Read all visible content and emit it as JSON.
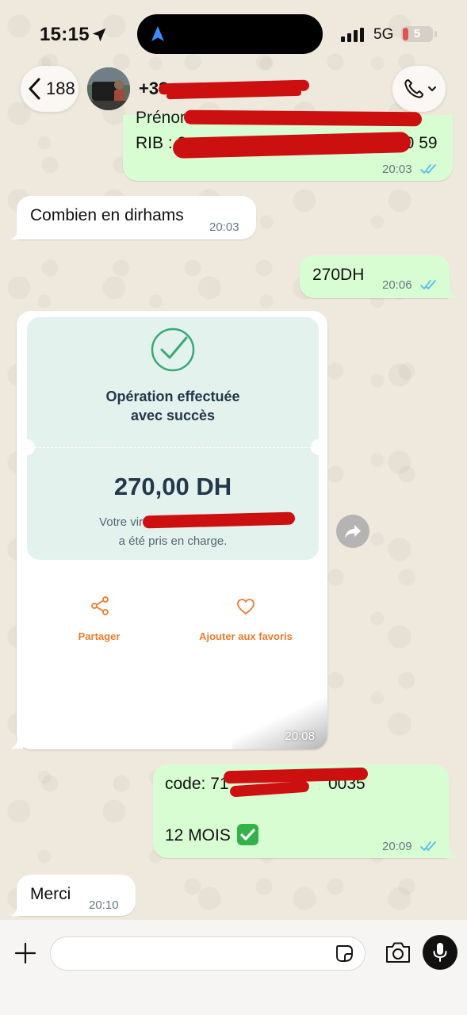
{
  "status_bar": {
    "time": "15:15",
    "network": "5G",
    "battery_level": "5",
    "battery_fraction": 0.05
  },
  "header": {
    "back_count": "188",
    "contact_name_visible": "+33"
  },
  "messages": [
    {
      "id": "m1",
      "direction": "out",
      "lines": [
        "Prénom: Abderrahmane",
        "RIB : 2",
        "00 59"
      ],
      "time": "20:03",
      "status": "read"
    },
    {
      "id": "m2",
      "direction": "in",
      "text": "Combien en dirhams",
      "time": "20:03"
    },
    {
      "id": "m3",
      "direction": "out",
      "text": "270DH",
      "time": "20:06",
      "status": "read"
    },
    {
      "id": "m4",
      "direction": "in",
      "type": "image",
      "time": "20:08"
    },
    {
      "id": "m5",
      "direction": "out",
      "lines": [
        "code: 71",
        "0035",
        "12 MOIS"
      ],
      "time": "20:09",
      "status": "read"
    },
    {
      "id": "m6",
      "direction": "in",
      "text": "Merci",
      "time": "20:10"
    }
  ],
  "receipt": {
    "title_line1": "Opération effectuée",
    "title_line2": "avec succès",
    "amount": "270,00 DH",
    "desc_line1": "Votre virement à Al",
    "desc_line2": "a été pris en charge.",
    "share_label": "Partager",
    "favorite_label": "Ajouter aux favoris"
  },
  "colors": {
    "outgoing_bubble": "#d9fdd3",
    "incoming_bubble": "#ffffff",
    "read_ticks": "#53bdeb",
    "receipt_card": "#e3f2ed",
    "receipt_accent": "#e87c2e",
    "receipt_check": "#3aa877",
    "redaction": "#cc0f0f"
  },
  "input": {
    "placeholder": "",
    "value": ""
  }
}
